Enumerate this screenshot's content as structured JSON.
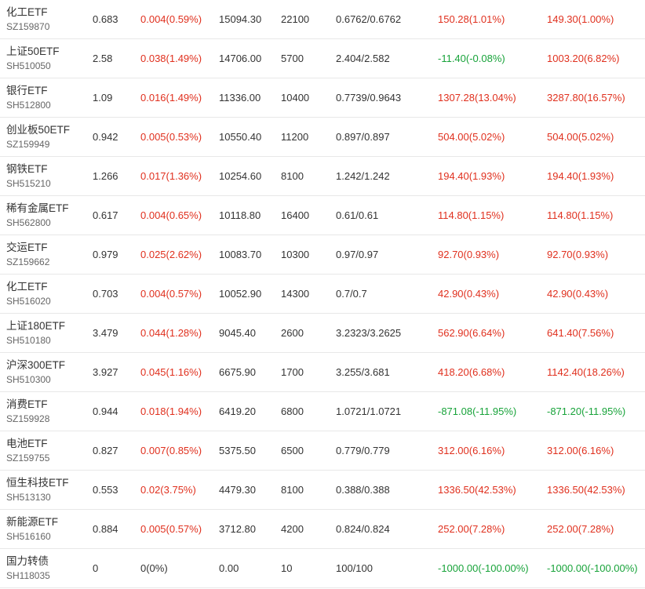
{
  "colors": {
    "up": "#e0301e",
    "down": "#18a33a",
    "flat": "#333333",
    "divider": "#e8e8e8"
  },
  "rows": [
    {
      "name": "化工ETF",
      "code": "SZ159870",
      "price": "0.683",
      "change": "0.004(0.59%)",
      "change_dir": "up",
      "market_value": "15094.30",
      "shares": "22100",
      "cost": "0.6762/0.6762",
      "pl_today": "150.28(1.01%)",
      "pl_today_dir": "up",
      "pl_total": "149.30(1.00%)",
      "pl_total_dir": "up"
    },
    {
      "name": "上证50ETF",
      "code": "SH510050",
      "price": "2.58",
      "change": "0.038(1.49%)",
      "change_dir": "up",
      "market_value": "14706.00",
      "shares": "5700",
      "cost": "2.404/2.582",
      "pl_today": "-11.40(-0.08%)",
      "pl_today_dir": "down",
      "pl_total": "1003.20(6.82%)",
      "pl_total_dir": "up"
    },
    {
      "name": "银行ETF",
      "code": "SH512800",
      "price": "1.09",
      "change": "0.016(1.49%)",
      "change_dir": "up",
      "market_value": "11336.00",
      "shares": "10400",
      "cost": "0.7739/0.9643",
      "pl_today": "1307.28(13.04%)",
      "pl_today_dir": "up",
      "pl_total": "3287.80(16.57%)",
      "pl_total_dir": "up"
    },
    {
      "name": "创业板50ETF",
      "code": "SZ159949",
      "price": "0.942",
      "change": "0.005(0.53%)",
      "change_dir": "up",
      "market_value": "10550.40",
      "shares": "11200",
      "cost": "0.897/0.897",
      "pl_today": "504.00(5.02%)",
      "pl_today_dir": "up",
      "pl_total": "504.00(5.02%)",
      "pl_total_dir": "up"
    },
    {
      "name": "钢铁ETF",
      "code": "SH515210",
      "price": "1.266",
      "change": "0.017(1.36%)",
      "change_dir": "up",
      "market_value": "10254.60",
      "shares": "8100",
      "cost": "1.242/1.242",
      "pl_today": "194.40(1.93%)",
      "pl_today_dir": "up",
      "pl_total": "194.40(1.93%)",
      "pl_total_dir": "up"
    },
    {
      "name": "稀有金属ETF",
      "code": "SH562800",
      "price": "0.617",
      "change": "0.004(0.65%)",
      "change_dir": "up",
      "market_value": "10118.80",
      "shares": "16400",
      "cost": "0.61/0.61",
      "pl_today": "114.80(1.15%)",
      "pl_today_dir": "up",
      "pl_total": "114.80(1.15%)",
      "pl_total_dir": "up"
    },
    {
      "name": "交运ETF",
      "code": "SZ159662",
      "price": "0.979",
      "change": "0.025(2.62%)",
      "change_dir": "up",
      "market_value": "10083.70",
      "shares": "10300",
      "cost": "0.97/0.97",
      "pl_today": "92.70(0.93%)",
      "pl_today_dir": "up",
      "pl_total": "92.70(0.93%)",
      "pl_total_dir": "up"
    },
    {
      "name": "化工ETF",
      "code": "SH516020",
      "price": "0.703",
      "change": "0.004(0.57%)",
      "change_dir": "up",
      "market_value": "10052.90",
      "shares": "14300",
      "cost": "0.7/0.7",
      "pl_today": "42.90(0.43%)",
      "pl_today_dir": "up",
      "pl_total": "42.90(0.43%)",
      "pl_total_dir": "up"
    },
    {
      "name": "上证180ETF",
      "code": "SH510180",
      "price": "3.479",
      "change": "0.044(1.28%)",
      "change_dir": "up",
      "market_value": "9045.40",
      "shares": "2600",
      "cost": "3.2323/3.2625",
      "pl_today": "562.90(6.64%)",
      "pl_today_dir": "up",
      "pl_total": "641.40(7.56%)",
      "pl_total_dir": "up"
    },
    {
      "name": "沪深300ETF",
      "code": "SH510300",
      "price": "3.927",
      "change": "0.045(1.16%)",
      "change_dir": "up",
      "market_value": "6675.90",
      "shares": "1700",
      "cost": "3.255/3.681",
      "pl_today": "418.20(6.68%)",
      "pl_today_dir": "up",
      "pl_total": "1142.40(18.26%)",
      "pl_total_dir": "up"
    },
    {
      "name": "消费ETF",
      "code": "SZ159928",
      "price": "0.944",
      "change": "0.018(1.94%)",
      "change_dir": "up",
      "market_value": "6419.20",
      "shares": "6800",
      "cost": "1.0721/1.0721",
      "pl_today": "-871.08(-11.95%)",
      "pl_today_dir": "down",
      "pl_total": "-871.20(-11.95%)",
      "pl_total_dir": "down"
    },
    {
      "name": "电池ETF",
      "code": "SZ159755",
      "price": "0.827",
      "change": "0.007(0.85%)",
      "change_dir": "up",
      "market_value": "5375.50",
      "shares": "6500",
      "cost": "0.779/0.779",
      "pl_today": "312.00(6.16%)",
      "pl_today_dir": "up",
      "pl_total": "312.00(6.16%)",
      "pl_total_dir": "up"
    },
    {
      "name": "恒生科技ETF",
      "code": "SH513130",
      "price": "0.553",
      "change": "0.02(3.75%)",
      "change_dir": "up",
      "market_value": "4479.30",
      "shares": "8100",
      "cost": "0.388/0.388",
      "pl_today": "1336.50(42.53%)",
      "pl_today_dir": "up",
      "pl_total": "1336.50(42.53%)",
      "pl_total_dir": "up"
    },
    {
      "name": "新能源ETF",
      "code": "SH516160",
      "price": "0.884",
      "change": "0.005(0.57%)",
      "change_dir": "up",
      "market_value": "3712.80",
      "shares": "4200",
      "cost": "0.824/0.824",
      "pl_today": "252.00(7.28%)",
      "pl_today_dir": "up",
      "pl_total": "252.00(7.28%)",
      "pl_total_dir": "up"
    },
    {
      "name": "国力转债",
      "code": "SH118035",
      "price": "0",
      "change": "0(0%)",
      "change_dir": "flat",
      "market_value": "0.00",
      "shares": "10",
      "cost": "100/100",
      "pl_today": "-1000.00(-100.00%)",
      "pl_today_dir": "down",
      "pl_total": "-1000.00(-100.00%)",
      "pl_total_dir": "down"
    }
  ]
}
